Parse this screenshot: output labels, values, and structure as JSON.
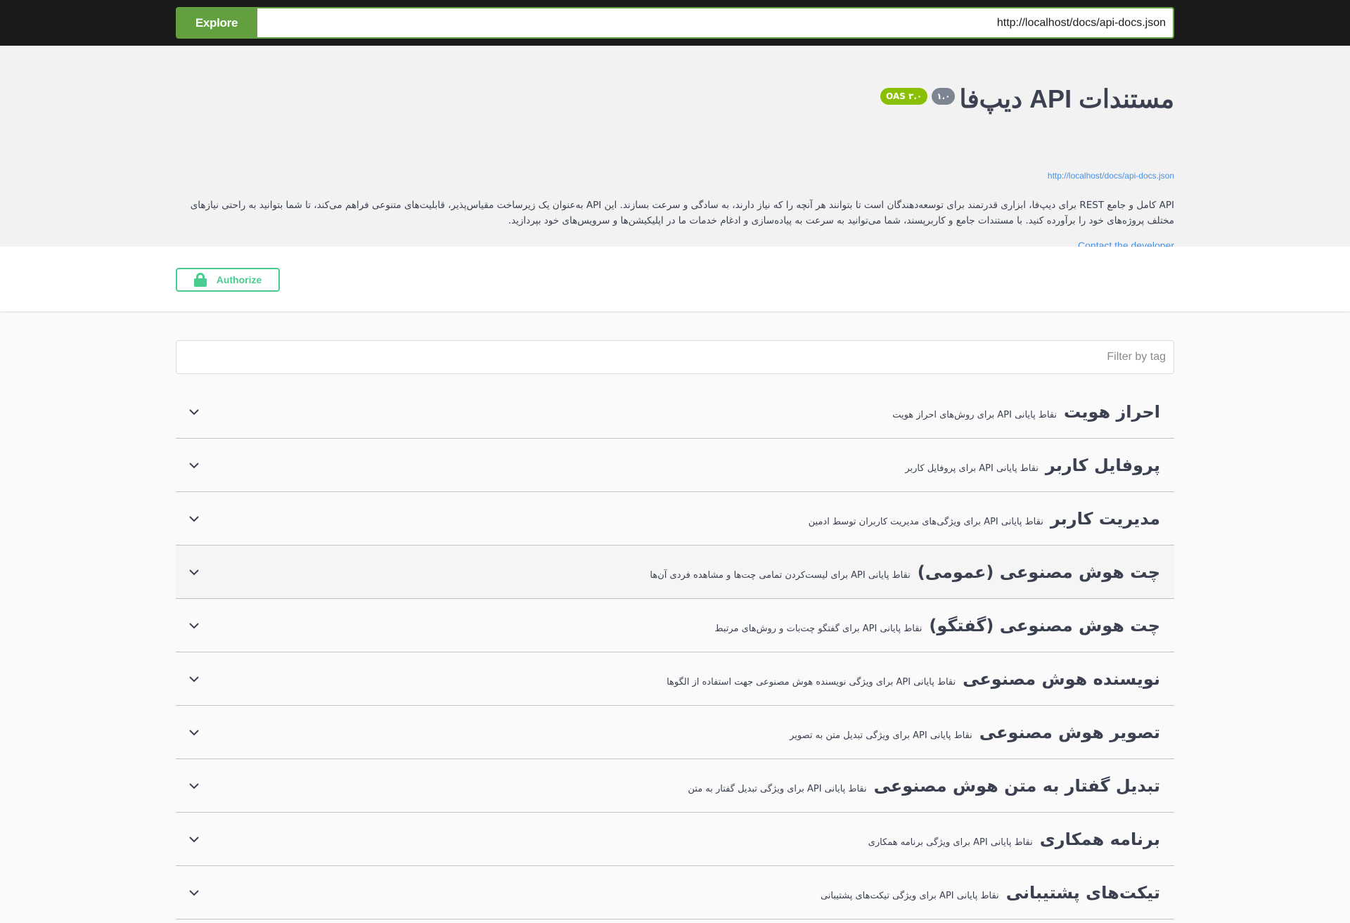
{
  "topbar": {
    "explore_label": "Explore",
    "url_value": "http://localhost/docs/api-docs.json"
  },
  "info": {
    "title": "مستندات API دیپ‌فا",
    "version_badge": "۱.۰",
    "oas_badge": "OAS ۳.۰",
    "spec_link": "http://localhost/docs/api-docs.json",
    "description_line1": "API کامل و جامع REST برای دیپ‌فا، ابزاری قدرتمند برای توسعه‌دهندگان است تا بتوانند هر آنچه را که نیاز دارند، به سادگی و سرعت بسازند. این API به‌عنوان یک زیرساخت مقیاس‌پذیر، قابلیت‌های متنوعی فراهم می‌کند، تا شما بتوانید به راحتی نیازهای",
    "description_line2": "مختلف پروژه‌های خود را برآورده کنید. با مستندات جامع و کاربرپسند، شما می‌توانید به سرعت به پیاده‌سازی و ادغام خدمات ما در اپلیکیشن‌ها و سرویس‌های خود بپردازید.",
    "contact_label": "Contact the developer"
  },
  "scheme": {
    "authorize_label": "Authorize"
  },
  "filter": {
    "placeholder": "Filter by tag"
  },
  "tags": [
    {
      "name": "احراز هویت",
      "desc": "نقاط پایانی API برای روش‌های احراز هویت"
    },
    {
      "name": "پروفایل کاربر",
      "desc": "نقاط پایانی API برای پروفایل کاربر"
    },
    {
      "name": "مدیریت کاربر",
      "desc": "نقاط پایانی API برای ویژگی‌های مدیریت کاربران توسط ادمین"
    },
    {
      "name": "چت هوش مصنوعی (عمومی)",
      "desc": "نقاط پایانی API برای لیست‌کردن تمامی چت‌ها و مشاهده فردی آن‌ها"
    },
    {
      "name": "چت هوش مصنوعی (گفتگو)",
      "desc": "نقاط پایانی API برای گفتگو چت‌بات و روش‌های مرتبط"
    },
    {
      "name": "نویسنده هوش مصنوعی",
      "desc": "نقاط پایانی API برای ویژگی نویسنده هوش مصنوعی جهت استفاده از الگوها"
    },
    {
      "name": "تصویر هوش مصنوعی",
      "desc": "نقاط پایانی API برای ویژگی تبدیل متن به تصویر"
    },
    {
      "name": "تبدیل گفتار به متن هوش مصنوعی",
      "desc": "نقاط پایانی API برای ویژگی تبدیل گفتار به متن"
    },
    {
      "name": "برنامه همکاری",
      "desc": "نقاط پایانی API برای ویژگی برنامه همکاری"
    },
    {
      "name": "تیکت‌های پشتیبانی",
      "desc": "نقاط پایانی API برای ویژگی تیکت‌های پشتیبانی"
    }
  ],
  "icons": {
    "chevron": "chevron-down-icon",
    "lock": "lock-icon"
  },
  "colors": {
    "explore_green": "#62a03f",
    "authorize_green": "#49cc90",
    "oas_badge": "#89bf04",
    "version_badge": "#7d8492",
    "link_blue": "#4990e2"
  }
}
